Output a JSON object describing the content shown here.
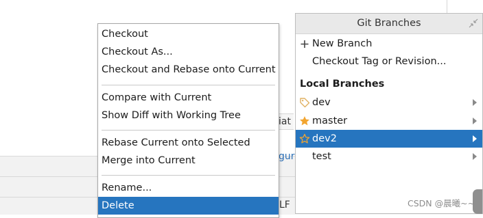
{
  "background": {
    "peek_left": "iat",
    "peek_link": "gur",
    "peek_status": "LF"
  },
  "context_menu": {
    "items": [
      {
        "label": "Checkout"
      },
      {
        "label": "Checkout As..."
      },
      {
        "label": "Checkout and Rebase onto Current"
      },
      {
        "label": "Compare with Current"
      },
      {
        "label": "Show Diff with Working Tree"
      },
      {
        "label": "Rebase Current onto Selected"
      },
      {
        "label": "Merge into Current"
      },
      {
        "label": "Rename..."
      },
      {
        "label": "Delete",
        "selected": true
      }
    ]
  },
  "git_branches": {
    "title": "Git Branches",
    "actions": [
      {
        "label": "New Branch",
        "icon": "plus-icon"
      },
      {
        "label": "Checkout Tag or Revision..."
      }
    ],
    "section_title": "Local Branches",
    "branches": [
      {
        "label": "dev",
        "icon": "tag-icon"
      },
      {
        "label": "master",
        "icon": "star-filled-icon"
      },
      {
        "label": "dev2",
        "icon": "star-outline-icon",
        "selected": true
      },
      {
        "label": "test"
      }
    ],
    "colors": {
      "selection": "#2675bf",
      "star": "#f2a530",
      "tag": "#e0b060"
    }
  },
  "watermark": "CSDN @晨曦~~"
}
